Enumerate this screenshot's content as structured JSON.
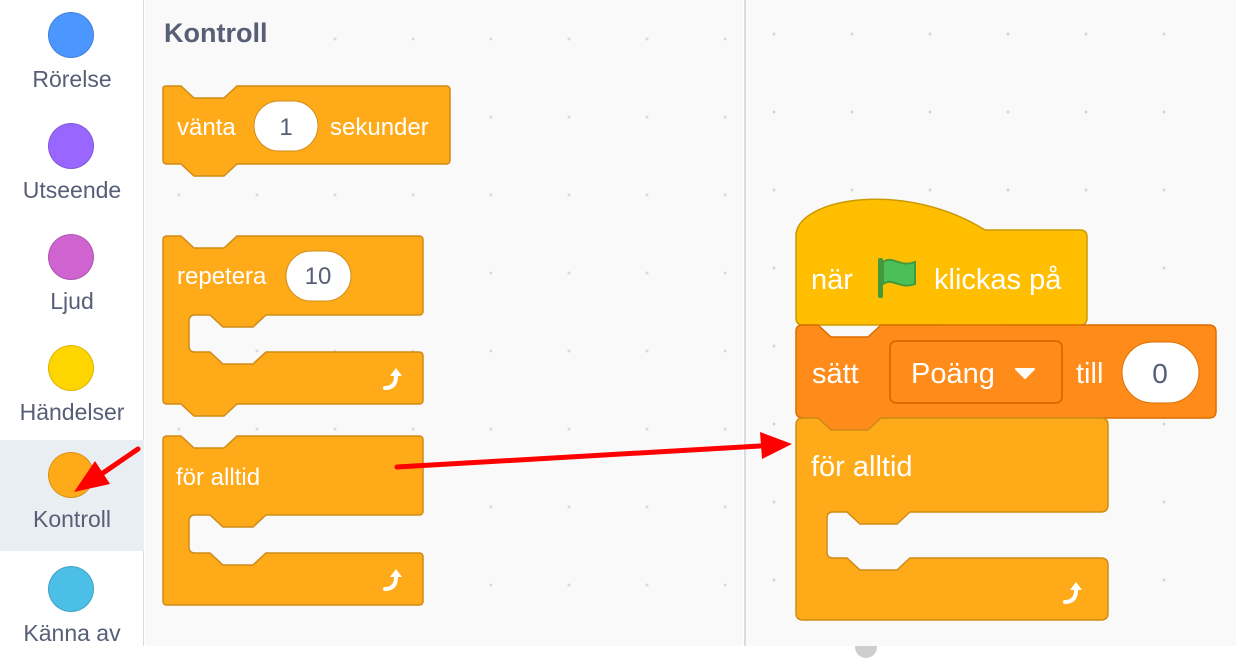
{
  "categories": [
    {
      "label": "Rörelse",
      "color": "#4c97ff"
    },
    {
      "label": "Utseende",
      "color": "#9966ff"
    },
    {
      "label": "Ljud",
      "color": "#cf63cf"
    },
    {
      "label": "Händelser",
      "color": "#ffd500"
    },
    {
      "label": "Kontroll",
      "color": "#ffab19",
      "selected": true
    },
    {
      "label": "Känna av",
      "color": "#4cbfe6"
    }
  ],
  "palette": {
    "title": "Kontroll",
    "wait_block": {
      "word": "vänta",
      "input": "1",
      "unit": "sekunder"
    },
    "repeat_block": {
      "word": "repetera",
      "input": "10"
    },
    "forever_block": {
      "label": "för alltid"
    }
  },
  "script": {
    "hat": {
      "before": "när",
      "flag_icon": "green-flag-icon",
      "after": "klickas på"
    },
    "set_block": {
      "word": "sätt",
      "variable": "Poäng",
      "to_word": "till",
      "value": "0"
    },
    "forever_block": {
      "label": "för alltid"
    }
  },
  "colors": {
    "control": "#ffab19",
    "control_border": "#cf8b17",
    "events": "#ffbf00",
    "events_border": "#cc9900",
    "variables": "#ff8c1a",
    "variables_border": "#db6e00",
    "arrow": "#ff0000"
  }
}
